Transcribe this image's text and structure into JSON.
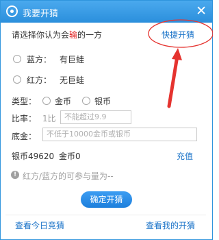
{
  "window": {
    "title": "我要开猜",
    "close_glyph": "✕"
  },
  "prompt": {
    "prefix": "请选择你认为会",
    "highlight": "输",
    "suffix": "的一方",
    "highlight_color": "#e02020"
  },
  "quick_guess_link": "快捷开猜",
  "sides": [
    {
      "label": "蓝方：",
      "value": "有巨蛙"
    },
    {
      "label": "红方：",
      "value": "无巨蛙"
    }
  ],
  "type": {
    "label": "类型：",
    "options": [
      "金币",
      "银币"
    ]
  },
  "ratio": {
    "label": "比率：",
    "prefix": "1比",
    "placeholder": "不能超过9.9"
  },
  "stake": {
    "label": "底金：",
    "placeholder": "不低于10000金币或银币"
  },
  "balance": {
    "silver": "银币49620",
    "gold": "金币0",
    "recharge": "充值"
  },
  "info": {
    "text": "红方/蓝方的可参与量为--"
  },
  "confirm_button": "确定开猜",
  "footer": {
    "left_link": "查看今日竞猜",
    "right_link": "查看我的开猜"
  },
  "colors": {
    "accent": "#2b8fdc",
    "annotation": "#e5332f",
    "link": "#1a73c8"
  }
}
